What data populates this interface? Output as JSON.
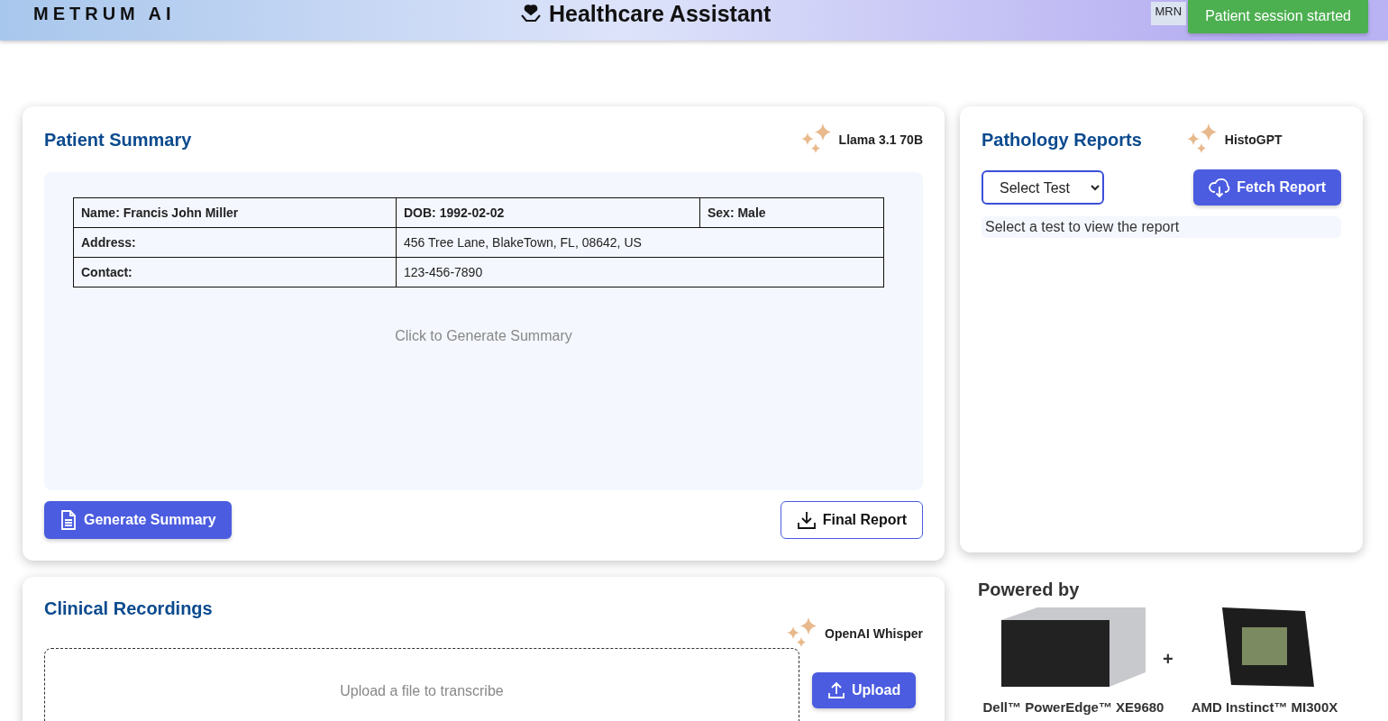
{
  "header": {
    "logo": "METRUM AI",
    "title": "Healthcare Assistant",
    "mrn_label": "MRN",
    "notification": "Patient session started"
  },
  "patient_summary": {
    "title": "Patient Summary",
    "model": "Llama 3.1 70B",
    "demographics": {
      "name": "Name: Francis John Miller",
      "dob": "DOB: 1992-02-02",
      "sex": "Sex: Male",
      "address_label": "Address:",
      "address": "456 Tree Lane, BlakeTown, FL, 08642, US",
      "contact_label": "Contact:",
      "contact": "123-456-7890"
    },
    "placeholder": "Click to Generate Summary",
    "buttons": [
      {
        "label": "Generate Summary",
        "kind": "primary"
      },
      {
        "label": "Final Report",
        "kind": "outline"
      }
    ]
  },
  "pathology_reports": {
    "title": "Pathology Reports",
    "model": "HistoGPT",
    "select": "Select Test",
    "button": "Fetch Report",
    "message": "Select a test to view the report"
  },
  "clinical_recordings": {
    "title": "Clinical Recordings",
    "model": "OpenAI Whisper",
    "dropzone": "Upload a file to transcribe",
    "button": "Upload"
  },
  "powered_by": {
    "title": "Powered by",
    "separator": "+",
    "items": [
      {
        "label": "Dell™ PowerEdge™ XE9680",
        "kind": "server"
      },
      {
        "label": "AMD Instinct™ MI300X",
        "kind": "chip"
      }
    ]
  }
}
